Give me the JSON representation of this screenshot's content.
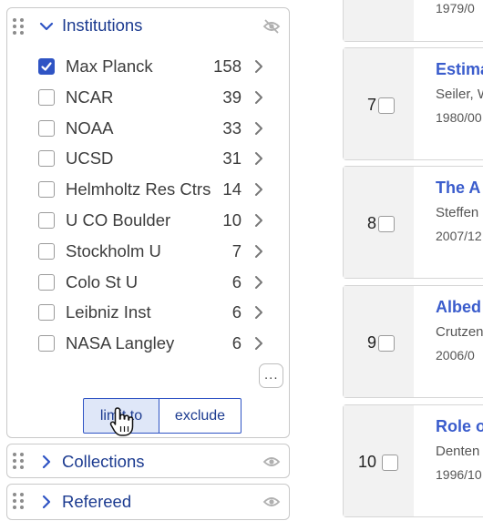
{
  "facets": {
    "institutions": {
      "title": "Institutions",
      "items": [
        {
          "label": "Max Planck",
          "count": "158",
          "checked": true
        },
        {
          "label": "NCAR",
          "count": "39",
          "checked": false
        },
        {
          "label": "NOAA",
          "count": "33",
          "checked": false
        },
        {
          "label": "UCSD",
          "count": "31",
          "checked": false
        },
        {
          "label": "Helmholtz Res Ctrs",
          "count": "14",
          "checked": false
        },
        {
          "label": "U CO Boulder",
          "count": "10",
          "checked": false
        },
        {
          "label": "Stockholm U",
          "count": "7",
          "checked": false
        },
        {
          "label": "Colo St U",
          "count": "6",
          "checked": false
        },
        {
          "label": "Leibniz Inst",
          "count": "6",
          "checked": false
        },
        {
          "label": "NASA Langley",
          "count": "6",
          "checked": false
        }
      ],
      "more_label": "...",
      "limit_label": "limit to",
      "exclude_label": "exclude"
    },
    "collections": {
      "title": "Collections"
    },
    "refereed": {
      "title": "Refereed"
    }
  },
  "results": [
    {
      "num": "",
      "title": "",
      "author": "",
      "date": "1979/0"
    },
    {
      "num": "7",
      "title": "Estima",
      "author": "Seiler, W",
      "date": "1980/00"
    },
    {
      "num": "8",
      "title": "The A",
      "author": "Steffen",
      "date": "2007/12"
    },
    {
      "num": "9",
      "title": "Albed",
      "author": "Crutzen",
      "date": "2006/0"
    },
    {
      "num": "10",
      "title": "Role o",
      "author": "Denten",
      "date": "1996/10"
    }
  ],
  "colors": {
    "accent": "#2f54c4",
    "title_blue": "#1c3b90",
    "link_blue": "#3a5ccc"
  }
}
